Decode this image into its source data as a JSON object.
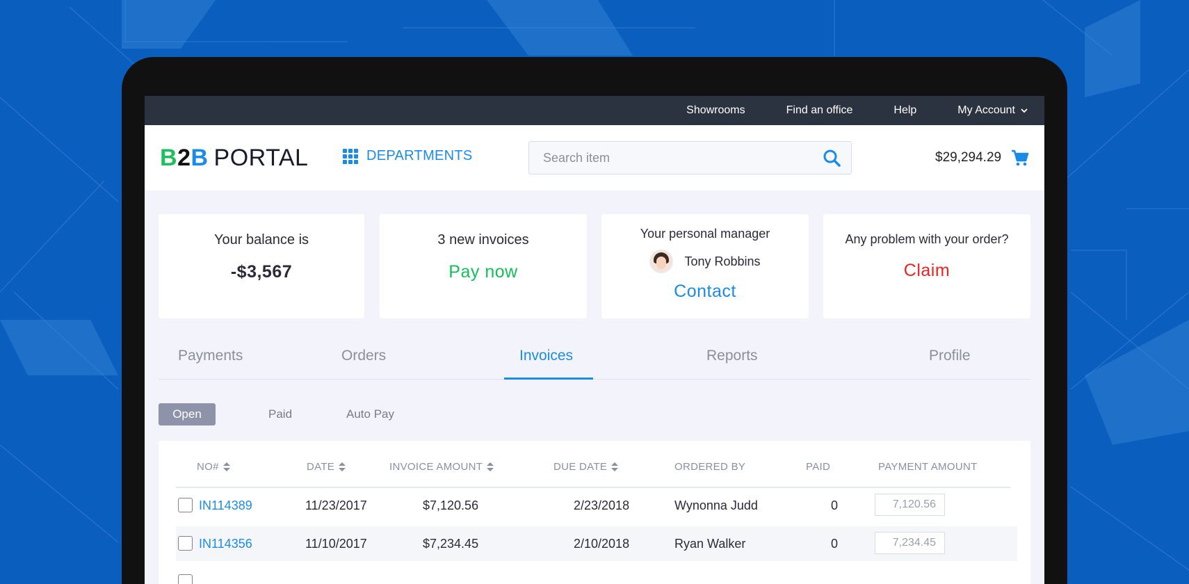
{
  "topbar": {
    "links": [
      "Showrooms",
      "Find an office",
      "Help",
      "My Account"
    ]
  },
  "header": {
    "logo": {
      "b1": "B",
      "n2": "2",
      "b2": "B",
      "rest": "PORTAL"
    },
    "departments_label": "DEPARTMENTS",
    "search_placeholder": "Search item",
    "cart_total": "$29,294.29"
  },
  "cards": {
    "balance": {
      "title": "Your balance is",
      "value": "-$3,567"
    },
    "invoices": {
      "title": "3 new invoices",
      "action": "Pay now"
    },
    "manager": {
      "title": "Your personal manager",
      "name": "Tony Robbins",
      "action": "Contact"
    },
    "problem": {
      "title": "Any problem with your order?",
      "action": "Claim"
    }
  },
  "tabs": [
    "Payments",
    "Orders",
    "Invoices",
    "Reports",
    "Profile"
  ],
  "active_tab": "Invoices",
  "subtabs": [
    "Open",
    "Paid",
    "Auto Pay"
  ],
  "active_subtab": "Open",
  "table": {
    "headers": [
      "NO#",
      "DATE",
      "INVOICE AMOUNT",
      "DUE DATE",
      "ORDERED BY",
      "PAID",
      "PAYMENT AMOUNT"
    ],
    "rows": [
      {
        "no": "IN114389",
        "date": "11/23/2017",
        "amount": "$7,120.56",
        "due": "2/23/2018",
        "ordered_by": "Wynonna Judd",
        "paid": "0",
        "payment": "7,120.56"
      },
      {
        "no": "IN114356",
        "date": "11/10/2017",
        "amount": "$7,234.45",
        "due": "2/10/2018",
        "ordered_by": "Ryan Walker",
        "paid": "0",
        "payment": "7,234.45"
      }
    ]
  },
  "colors": {
    "background": "#0a5fbe",
    "topbar": "#2b3240",
    "accent_blue": "#1a8ce8",
    "green": "#14bf5a",
    "red": "#ee2222"
  }
}
